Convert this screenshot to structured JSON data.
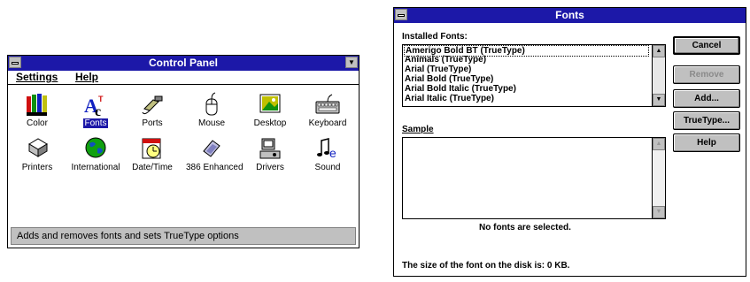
{
  "control_panel": {
    "title": "Control Panel",
    "menu": [
      "Settings",
      "Help"
    ],
    "icons": [
      {
        "label": "Color",
        "icon": "color-icon"
      },
      {
        "label": "Fonts",
        "icon": "fonts-icon",
        "selected": true
      },
      {
        "label": "Ports",
        "icon": "ports-icon"
      },
      {
        "label": "Mouse",
        "icon": "mouse-icon"
      },
      {
        "label": "Desktop",
        "icon": "desktop-icon"
      },
      {
        "label": "Keyboard",
        "icon": "keyboard-icon"
      },
      {
        "label": "Printers",
        "icon": "printers-icon"
      },
      {
        "label": "International",
        "icon": "international-icon"
      },
      {
        "label": "Date/Time",
        "icon": "date-time-icon"
      },
      {
        "label": "386 Enhanced",
        "icon": "386-enhanced-icon"
      },
      {
        "label": "Drivers",
        "icon": "drivers-icon"
      },
      {
        "label": "Sound",
        "icon": "sound-icon"
      }
    ],
    "status": "Adds and removes fonts and sets TrueType options"
  },
  "fonts_dialog": {
    "title": "Fonts",
    "installed_label": "Installed Fonts:",
    "installed_fonts": [
      "Amerigo Bold BT (TrueType)",
      "Animals (TrueType)",
      "Arial (TrueType)",
      "Arial Bold (TrueType)",
      "Arial Bold Italic (TrueType)",
      "Arial Italic (TrueType)"
    ],
    "sample_label": "Sample",
    "no_selection_msg": "No fonts are selected.",
    "size_msg": "The size of the font on the disk is:  0 KB.",
    "buttons": {
      "cancel": "Cancel",
      "remove": "Remove",
      "add": "Add...",
      "truetype": "TrueType...",
      "help": "Help"
    }
  },
  "colors": {
    "titlebar": "#1c18a8",
    "button_face": "#c0c0c0"
  }
}
